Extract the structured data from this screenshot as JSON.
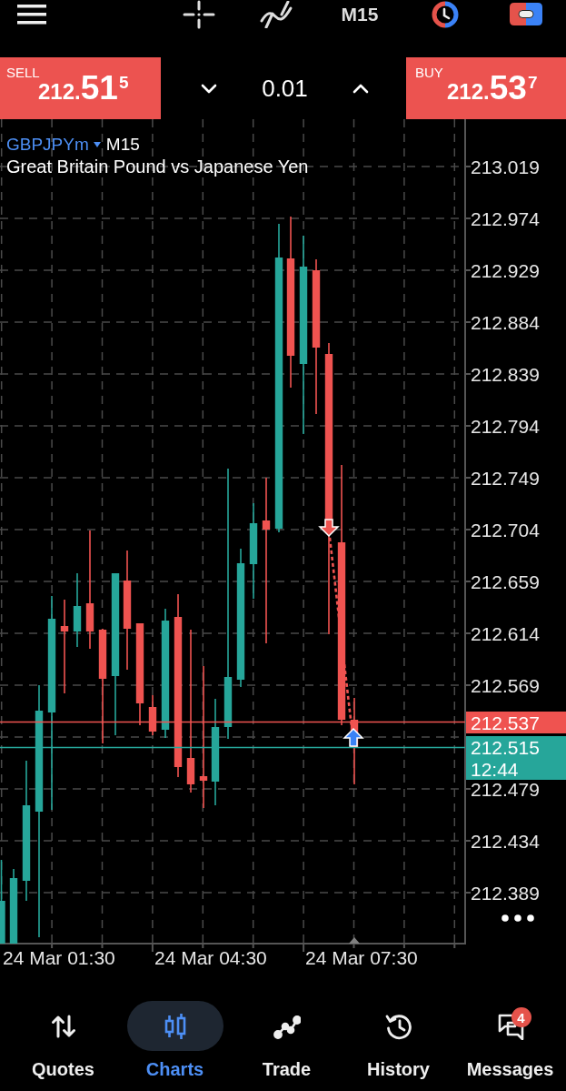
{
  "toolbar": {
    "timeframe": "M15"
  },
  "trade_panel": {
    "sell": {
      "label": "SELL",
      "price": {
        "small": "212.",
        "large": "51",
        "raised": "5"
      }
    },
    "volume": "0.01",
    "buy": {
      "label": "BUY",
      "price": {
        "small": "212.",
        "large": "53",
        "raised": "7"
      }
    }
  },
  "chart": {
    "symbol": "GBPJPYm",
    "timeframe": "M15",
    "description": "Great Britain Pound vs Japanese Yen",
    "price_axis": [
      "213.019",
      "212.974",
      "212.929",
      "212.884",
      "212.839",
      "212.794",
      "212.749",
      "212.704",
      "212.659",
      "212.614",
      "212.569",
      "212.479",
      "212.434",
      "212.389"
    ],
    "ask_tag": "212.537",
    "bid_tag": {
      "price": "212.515",
      "countdown": "12:44"
    },
    "time_axis": [
      "24 Mar 01:30",
      "24 Mar 04:30",
      "24 Mar 07:30"
    ]
  },
  "bottom_nav": [
    {
      "label": "Quotes",
      "selected": false
    },
    {
      "label": "Charts",
      "selected": true
    },
    {
      "label": "Trade",
      "selected": false
    },
    {
      "label": "History",
      "selected": false
    },
    {
      "label": "Messages",
      "selected": false,
      "badge": "4"
    }
  ]
}
